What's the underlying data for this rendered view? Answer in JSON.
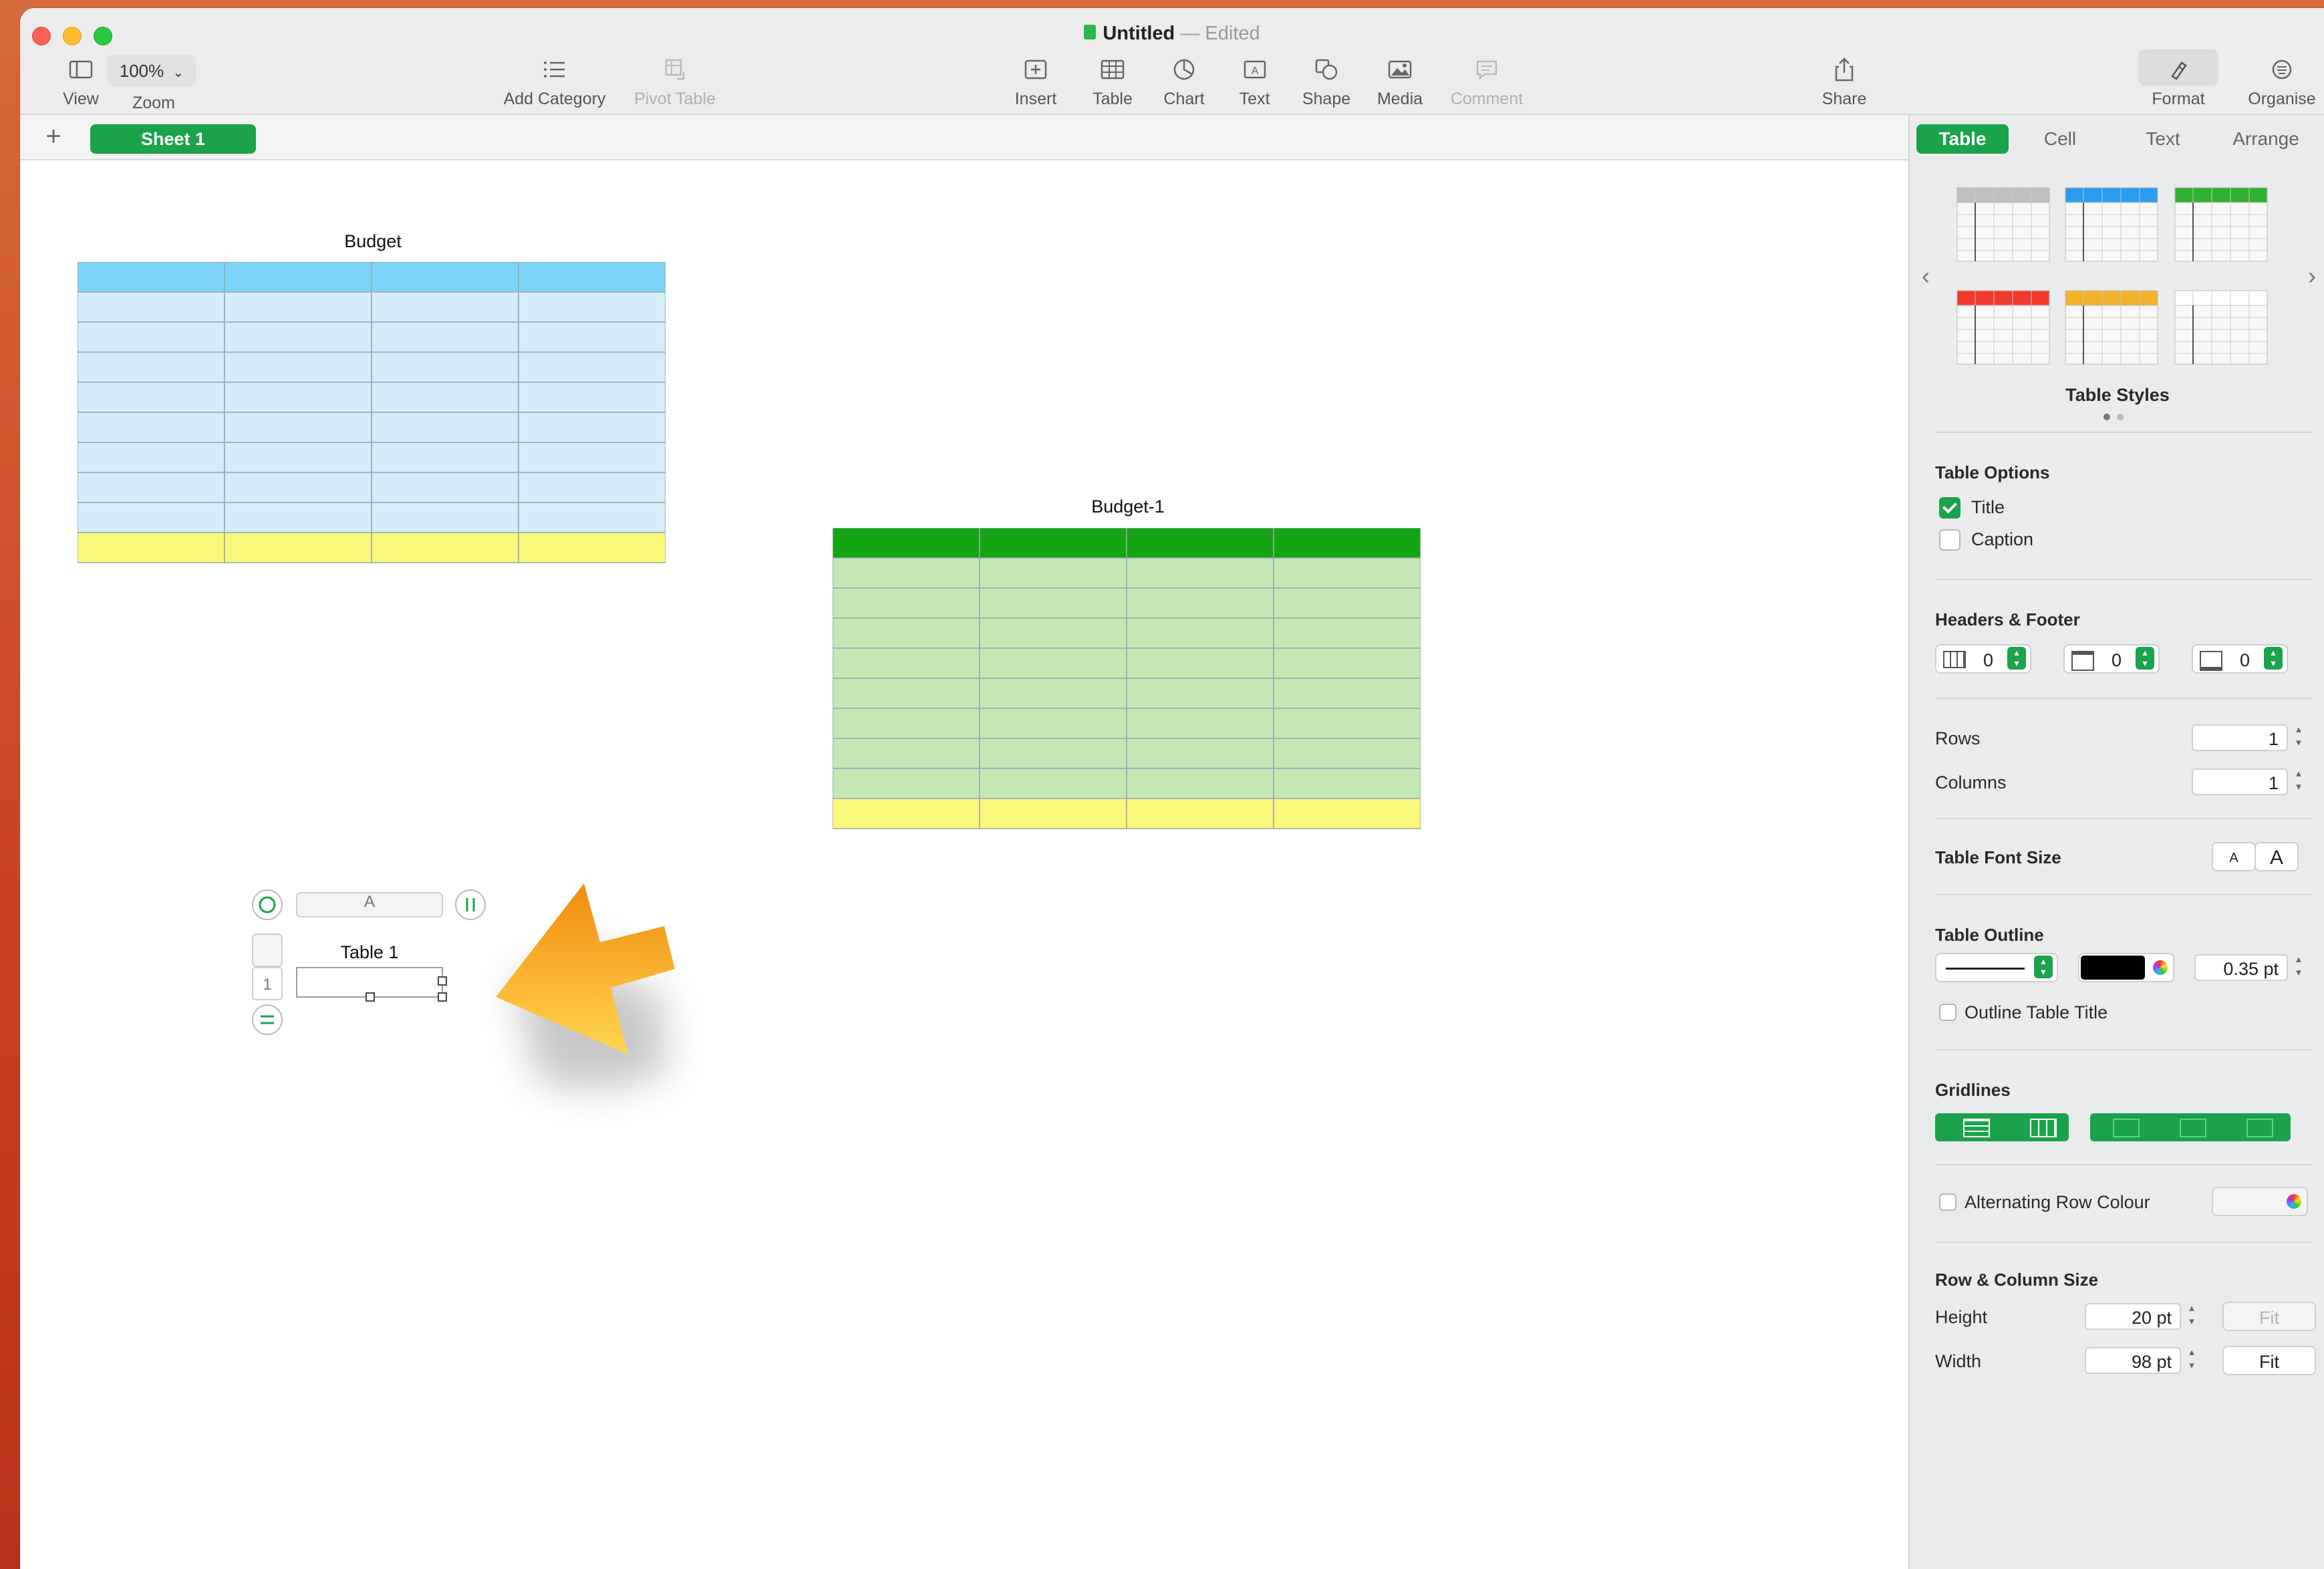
{
  "window": {
    "title": "Untitled",
    "status": "Edited",
    "separator": "—"
  },
  "toolbar": {
    "view_label": "View",
    "zoom_label": "Zoom",
    "zoom_value": "100%",
    "add_category_label": "Add Category",
    "pivot_table_label": "Pivot Table",
    "insert_label": "Insert",
    "table_label": "Table",
    "chart_label": "Chart",
    "text_label": "Text",
    "shape_label": "Shape",
    "media_label": "Media",
    "comment_label": "Comment",
    "share_label": "Share",
    "format_label": "Format",
    "organise_label": "Organise"
  },
  "sheets": {
    "add_symbol": "+",
    "tabs": [
      {
        "label": "Sheet 1",
        "active": true
      }
    ]
  },
  "canvas": {
    "table_a": {
      "title": "Budget",
      "header_color": "#7dd3f8",
      "body_color": "#d3eef9",
      "footer_color": "#faf87a",
      "rows": 10,
      "cols": 4
    },
    "table_b": {
      "title": "Budget-1",
      "header_color": "#14a514",
      "body_color": "#c3e8b6",
      "footer_color": "#faf87a",
      "rows": 10,
      "cols": 4
    },
    "table_c": {
      "title": "Table 1",
      "column_label": "A",
      "row_label": "1"
    }
  },
  "sidebar": {
    "tabs": [
      "Table",
      "Cell",
      "Text",
      "Arrange"
    ],
    "active_tab": "Table",
    "table_styles_label": "Table Styles",
    "table_styles": [
      {
        "accent": "#bfbfbf"
      },
      {
        "accent": "#2c9cf0"
      },
      {
        "accent": "#30b030"
      },
      {
        "accent": "#f23b2c"
      },
      {
        "accent": "#f4b12a"
      },
      {
        "accent": "#ffffff"
      }
    ],
    "table_options": {
      "heading": "Table Options",
      "title_label": "Title",
      "title_checked": true,
      "caption_label": "Caption",
      "caption_checked": false
    },
    "headers_footer": {
      "heading": "Headers & Footer",
      "header_rows": "0",
      "header_columns": "0",
      "footer_rows": "0"
    },
    "rows_label": "Rows",
    "rows_value": "1",
    "columns_label": "Columns",
    "columns_value": "1",
    "font_size_label": "Table Font Size",
    "font_small": "A",
    "font_large": "A",
    "outline": {
      "heading": "Table Outline",
      "color": "#000000",
      "width": "0.35 pt",
      "outline_title_label": "Outline Table Title"
    },
    "gridlines_label": "Gridlines",
    "alternating_label": "Alternating Row Colour",
    "row_col_size": {
      "heading": "Row & Column Size",
      "height_label": "Height",
      "height_value": "20 pt",
      "width_label": "Width",
      "width_value": "98 pt",
      "fit_label": "Fit"
    }
  }
}
